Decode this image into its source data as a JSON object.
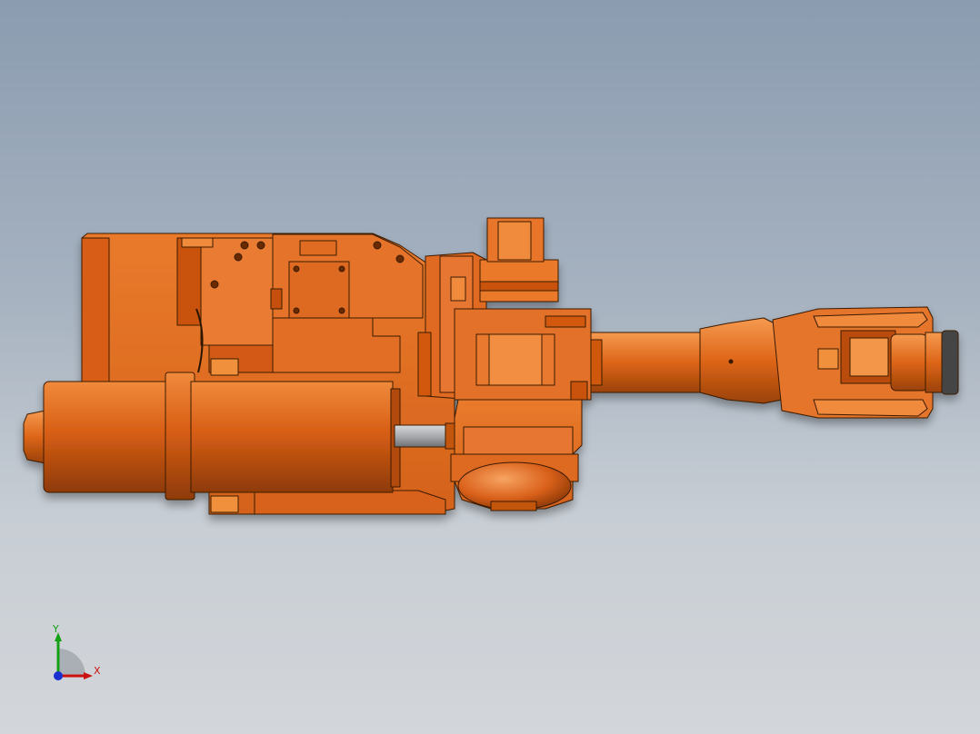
{
  "viewport": {
    "background_top": "#8b9cb0",
    "background_bottom": "#d3d6da"
  },
  "model": {
    "part_color": "#e0661c",
    "edge_color": "#3a1a05",
    "shaft_color": "#b7b9bc"
  },
  "triad": {
    "x_label": "X",
    "y_label": "Y",
    "x_color": "#cc1111",
    "y_color": "#14a014",
    "z_color": "#1a2fd0"
  }
}
